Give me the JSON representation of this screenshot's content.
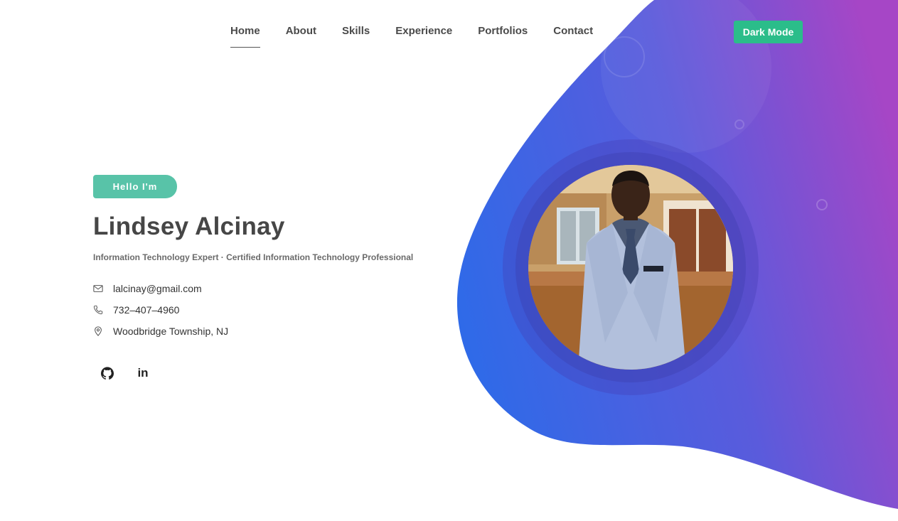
{
  "nav": {
    "links": [
      "Home",
      "About",
      "Skills",
      "Experience",
      "Portfolios",
      "Contact"
    ],
    "active": "Home",
    "dark_mode_label": "Dark Mode"
  },
  "hero": {
    "badge": "Hello I'm",
    "name": "Lindsey Alcinay",
    "subtitle": "Information Technology Expert · Certified Information Technology Professional",
    "contacts": {
      "email": "lalcinay@gmail.com",
      "phone": "732–407–4960",
      "location": "Woodbridge Township, NJ"
    },
    "socials": {
      "github_icon": "github-icon",
      "linkedin_text": "in"
    }
  },
  "colors": {
    "accent_green": "#2bbd8a",
    "badge_green": "#58c3a8",
    "blob_blue": "#2f6ae8",
    "blob_purple": "#a24bc8"
  }
}
